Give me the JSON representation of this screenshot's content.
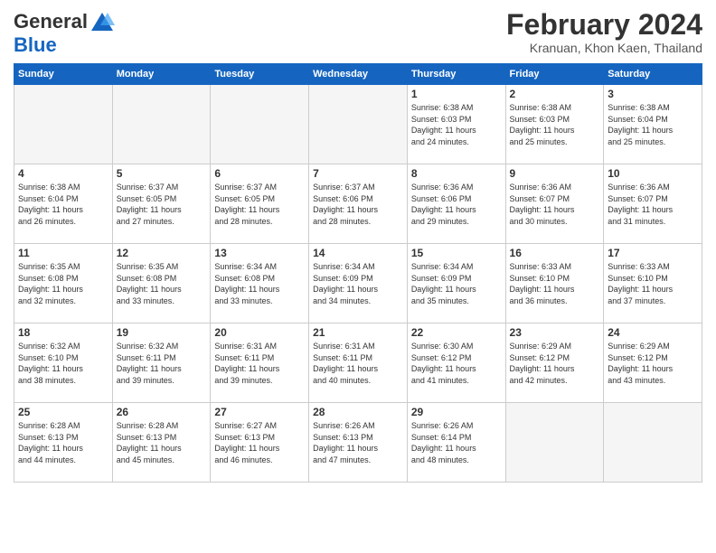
{
  "header": {
    "logo_general": "General",
    "logo_blue": "Blue",
    "month_title": "February 2024",
    "location": "Kranuan, Khon Kaen, Thailand"
  },
  "weekdays": [
    "Sunday",
    "Monday",
    "Tuesday",
    "Wednesday",
    "Thursday",
    "Friday",
    "Saturday"
  ],
  "weeks": [
    [
      {
        "day": "",
        "info": ""
      },
      {
        "day": "",
        "info": ""
      },
      {
        "day": "",
        "info": ""
      },
      {
        "day": "",
        "info": ""
      },
      {
        "day": "1",
        "info": "Sunrise: 6:38 AM\nSunset: 6:03 PM\nDaylight: 11 hours\nand 24 minutes."
      },
      {
        "day": "2",
        "info": "Sunrise: 6:38 AM\nSunset: 6:03 PM\nDaylight: 11 hours\nand 25 minutes."
      },
      {
        "day": "3",
        "info": "Sunrise: 6:38 AM\nSunset: 6:04 PM\nDaylight: 11 hours\nand 25 minutes."
      }
    ],
    [
      {
        "day": "4",
        "info": "Sunrise: 6:38 AM\nSunset: 6:04 PM\nDaylight: 11 hours\nand 26 minutes."
      },
      {
        "day": "5",
        "info": "Sunrise: 6:37 AM\nSunset: 6:05 PM\nDaylight: 11 hours\nand 27 minutes."
      },
      {
        "day": "6",
        "info": "Sunrise: 6:37 AM\nSunset: 6:05 PM\nDaylight: 11 hours\nand 28 minutes."
      },
      {
        "day": "7",
        "info": "Sunrise: 6:37 AM\nSunset: 6:06 PM\nDaylight: 11 hours\nand 28 minutes."
      },
      {
        "day": "8",
        "info": "Sunrise: 6:36 AM\nSunset: 6:06 PM\nDaylight: 11 hours\nand 29 minutes."
      },
      {
        "day": "9",
        "info": "Sunrise: 6:36 AM\nSunset: 6:07 PM\nDaylight: 11 hours\nand 30 minutes."
      },
      {
        "day": "10",
        "info": "Sunrise: 6:36 AM\nSunset: 6:07 PM\nDaylight: 11 hours\nand 31 minutes."
      }
    ],
    [
      {
        "day": "11",
        "info": "Sunrise: 6:35 AM\nSunset: 6:08 PM\nDaylight: 11 hours\nand 32 minutes."
      },
      {
        "day": "12",
        "info": "Sunrise: 6:35 AM\nSunset: 6:08 PM\nDaylight: 11 hours\nand 33 minutes."
      },
      {
        "day": "13",
        "info": "Sunrise: 6:34 AM\nSunset: 6:08 PM\nDaylight: 11 hours\nand 33 minutes."
      },
      {
        "day": "14",
        "info": "Sunrise: 6:34 AM\nSunset: 6:09 PM\nDaylight: 11 hours\nand 34 minutes."
      },
      {
        "day": "15",
        "info": "Sunrise: 6:34 AM\nSunset: 6:09 PM\nDaylight: 11 hours\nand 35 minutes."
      },
      {
        "day": "16",
        "info": "Sunrise: 6:33 AM\nSunset: 6:10 PM\nDaylight: 11 hours\nand 36 minutes."
      },
      {
        "day": "17",
        "info": "Sunrise: 6:33 AM\nSunset: 6:10 PM\nDaylight: 11 hours\nand 37 minutes."
      }
    ],
    [
      {
        "day": "18",
        "info": "Sunrise: 6:32 AM\nSunset: 6:10 PM\nDaylight: 11 hours\nand 38 minutes."
      },
      {
        "day": "19",
        "info": "Sunrise: 6:32 AM\nSunset: 6:11 PM\nDaylight: 11 hours\nand 39 minutes."
      },
      {
        "day": "20",
        "info": "Sunrise: 6:31 AM\nSunset: 6:11 PM\nDaylight: 11 hours\nand 39 minutes."
      },
      {
        "day": "21",
        "info": "Sunrise: 6:31 AM\nSunset: 6:11 PM\nDaylight: 11 hours\nand 40 minutes."
      },
      {
        "day": "22",
        "info": "Sunrise: 6:30 AM\nSunset: 6:12 PM\nDaylight: 11 hours\nand 41 minutes."
      },
      {
        "day": "23",
        "info": "Sunrise: 6:29 AM\nSunset: 6:12 PM\nDaylight: 11 hours\nand 42 minutes."
      },
      {
        "day": "24",
        "info": "Sunrise: 6:29 AM\nSunset: 6:12 PM\nDaylight: 11 hours\nand 43 minutes."
      }
    ],
    [
      {
        "day": "25",
        "info": "Sunrise: 6:28 AM\nSunset: 6:13 PM\nDaylight: 11 hours\nand 44 minutes."
      },
      {
        "day": "26",
        "info": "Sunrise: 6:28 AM\nSunset: 6:13 PM\nDaylight: 11 hours\nand 45 minutes."
      },
      {
        "day": "27",
        "info": "Sunrise: 6:27 AM\nSunset: 6:13 PM\nDaylight: 11 hours\nand 46 minutes."
      },
      {
        "day": "28",
        "info": "Sunrise: 6:26 AM\nSunset: 6:13 PM\nDaylight: 11 hours\nand 47 minutes."
      },
      {
        "day": "29",
        "info": "Sunrise: 6:26 AM\nSunset: 6:14 PM\nDaylight: 11 hours\nand 48 minutes."
      },
      {
        "day": "",
        "info": ""
      },
      {
        "day": "",
        "info": ""
      }
    ]
  ]
}
